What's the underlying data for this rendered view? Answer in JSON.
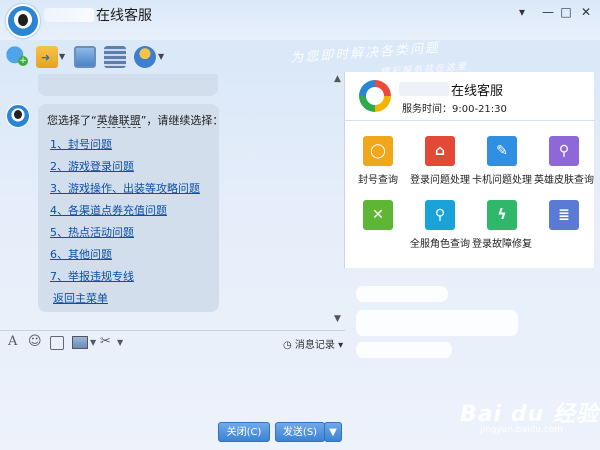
{
  "window": {
    "title": "在线客服",
    "controls": [
      "▾",
      "—",
      "□",
      "✕"
    ]
  },
  "banner": {
    "slogan_line1": "为您即时解决各类问题",
    "slogan_line2": "精彩服务就在这里"
  },
  "chat": {
    "intro_prefix": "您选择了“",
    "intro_highlight": "英雄联盟",
    "intro_suffix": "”，请继续选择：",
    "options": [
      "1、封号问题",
      "2、游戏登录问题",
      "3、游戏操作、出装等攻略问题",
      "4、各渠道点券充值问题",
      "5、热点活动问题",
      "6、其他问题",
      "7、举报违规专线"
    ],
    "back_link": "返回主菜单"
  },
  "input_toolbar": {
    "font_icon": "A",
    "emoji_icon": "☺",
    "history_label": "消息记录"
  },
  "buttons": {
    "close": "关闭(C)",
    "send": "发送(S)"
  },
  "panel": {
    "title": "在线客服",
    "service_hours": "服务时间：9:00-21:30",
    "tiles": [
      {
        "label": "封号查询",
        "icon": "ring-icon",
        "color": "#f0a71c"
      },
      {
        "label": "登录问题处理",
        "icon": "house-x-icon",
        "color": "#e24a37"
      },
      {
        "label": "卡机问题处理",
        "icon": "edit-icon",
        "color": "#2f8fe3"
      },
      {
        "label": "英雄皮肤查询",
        "icon": "person-search-icon",
        "color": "#8e68d8"
      },
      {
        "label": "",
        "icon": "card-x-icon",
        "color": "#5fb534"
      },
      {
        "label": "全服角色查询",
        "icon": "user-search-icon",
        "color": "#1aa3d8"
      },
      {
        "label": "登录故障修复",
        "icon": "bolt-icon",
        "color": "#2fb86a"
      },
      {
        "label": "",
        "icon": "doc-icon",
        "color": "#5a7ad4"
      }
    ]
  },
  "watermark": {
    "brand": "Bai du 经验",
    "url": "jingyan.baidu.com"
  }
}
